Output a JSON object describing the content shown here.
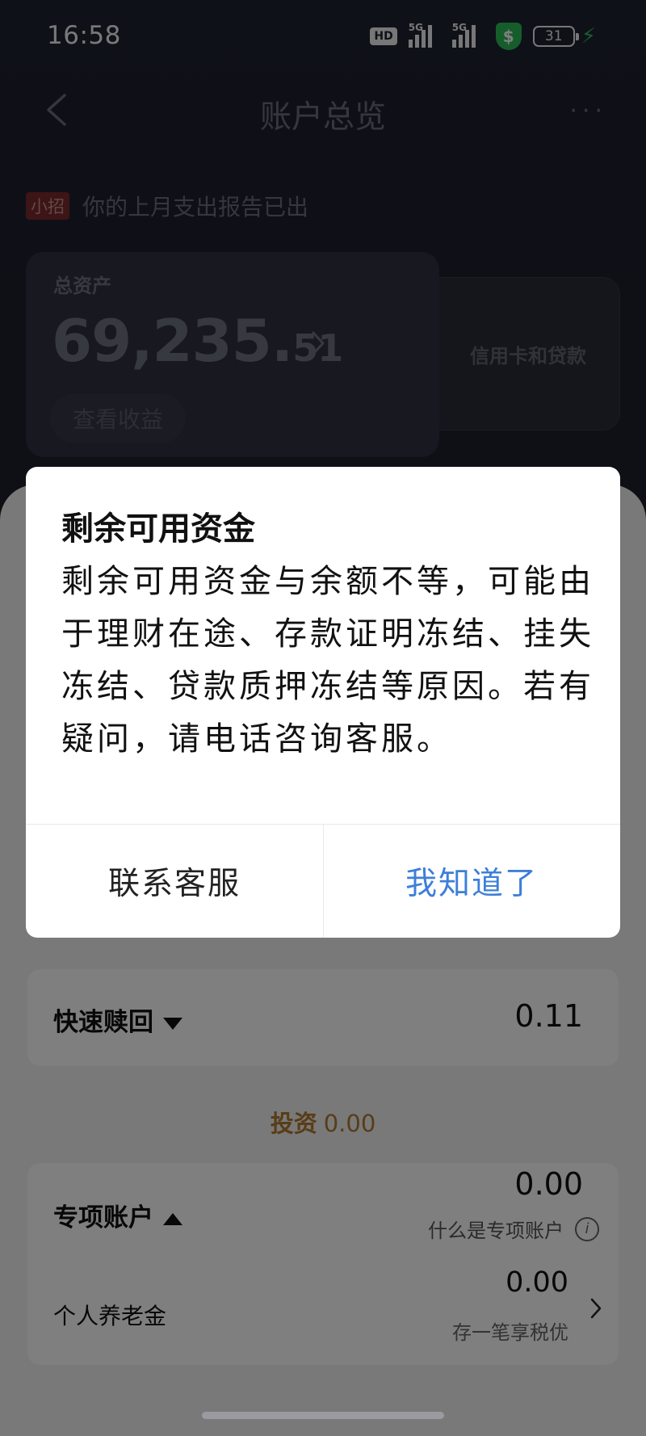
{
  "status_bar": {
    "time": "16:58",
    "hd_label": "HD",
    "net1": "5G",
    "net2": "5G",
    "shield_symbol": "$",
    "battery": "31"
  },
  "nav": {
    "title": "账户总览",
    "back_icon": "chevron-left-icon",
    "more_label": "···"
  },
  "notice": {
    "tag": "小招",
    "text": "你的上月支出报告已出"
  },
  "asset_card": {
    "label": "总资产",
    "value_main": "69,235.",
    "value_cents": "51",
    "earnings_button": "查看收益"
  },
  "credit_card": {
    "label": "信用卡和贷款"
  },
  "redeem": {
    "label": "快速赎回",
    "value": "0.11"
  },
  "invest": {
    "label": "投资",
    "value": "0.00"
  },
  "special_account": {
    "label": "专项账户",
    "value": "0.00",
    "help": "什么是专项账户",
    "info_icon": "i",
    "pension_label": "个人养老金",
    "pension_value": "0.00",
    "pension_sub": "存一笔享税优"
  },
  "dialog": {
    "title": "剩余可用资金",
    "body": "剩余可用资金与余额不等，可能由于理财在途、存款证明冻结、挂失冻结、贷款质押冻结等原因。若有疑问，请电话咨询客服。",
    "contact_button": "联系客服",
    "ok_button": "我知道了"
  },
  "colors": {
    "accent_blue": "#3d7fd9",
    "invest_gold": "#b07a2c",
    "shield_green": "#2dbb59"
  }
}
